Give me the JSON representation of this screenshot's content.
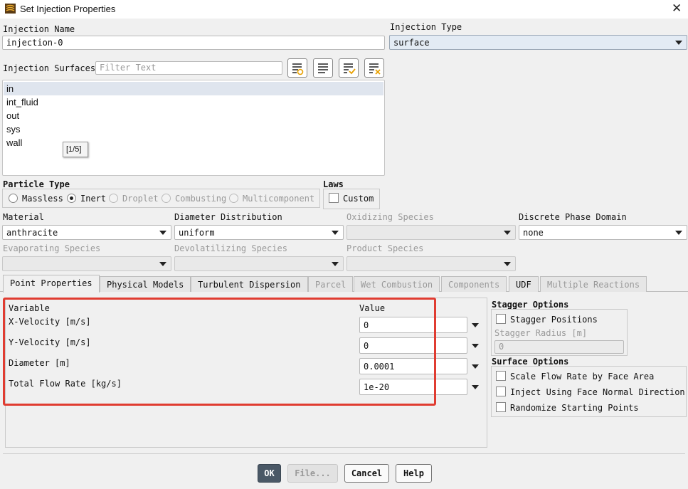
{
  "window": {
    "title": "Set Injection Properties"
  },
  "injection_name": {
    "label": "Injection Name",
    "value": "injection-0"
  },
  "injection_type": {
    "label": "Injection Type",
    "value": "surface"
  },
  "injection_surfaces": {
    "label": "Injection Surfaces",
    "filter_placeholder": "Filter Text",
    "items": [
      "in",
      "int_fluid",
      "out",
      "sys",
      "wall"
    ],
    "selected": "in",
    "tooltip": "[1/5]"
  },
  "particle_type": {
    "label": "Particle Type",
    "options": [
      "Massless",
      "Inert",
      "Droplet",
      "Combusting",
      "Multicomponent"
    ],
    "selected": "Inert"
  },
  "laws": {
    "label": "Laws",
    "custom_label": "Custom"
  },
  "material": {
    "label": "Material",
    "value": "anthracite"
  },
  "diameter_distribution": {
    "label": "Diameter Distribution",
    "value": "uniform"
  },
  "oxidizing_species": {
    "label": "Oxidizing Species",
    "value": ""
  },
  "discrete_phase_domain": {
    "label": "Discrete Phase Domain",
    "value": "none"
  },
  "evaporating_species": {
    "label": "Evaporating Species",
    "value": ""
  },
  "devolatilizing_species": {
    "label": "Devolatilizing Species",
    "value": ""
  },
  "product_species": {
    "label": "Product Species",
    "value": ""
  },
  "tabs": [
    "Point Properties",
    "Physical Models",
    "Turbulent Dispersion",
    "Parcel",
    "Wet Combustion",
    "Components",
    "UDF",
    "Multiple Reactions"
  ],
  "active_tab": "Point Properties",
  "point_properties": {
    "variable_header": "Variable",
    "value_header": "Value",
    "rows": [
      {
        "variable": "X-Velocity [m/s]",
        "value": "0"
      },
      {
        "variable": "Y-Velocity [m/s]",
        "value": "0"
      },
      {
        "variable": "Diameter [m]",
        "value": "0.0001"
      },
      {
        "variable": "Total Flow Rate [kg/s]",
        "value": "1e-20"
      }
    ]
  },
  "stagger_options": {
    "label": "Stagger Options",
    "positions_label": "Stagger Positions",
    "radius_label": "Stagger Radius [m]",
    "radius_value": "0"
  },
  "surface_options": {
    "label": "Surface Options",
    "items": [
      "Scale Flow Rate by Face Area",
      "Inject Using Face Normal Direction",
      "Randomize Starting Points"
    ]
  },
  "buttons": {
    "ok": "OK",
    "file": "File...",
    "cancel": "Cancel",
    "help": "Help"
  },
  "colors": {
    "highlight_box": "#e03c31",
    "selected_row": "#dfe5ee",
    "ok_button": "#4a5866"
  }
}
